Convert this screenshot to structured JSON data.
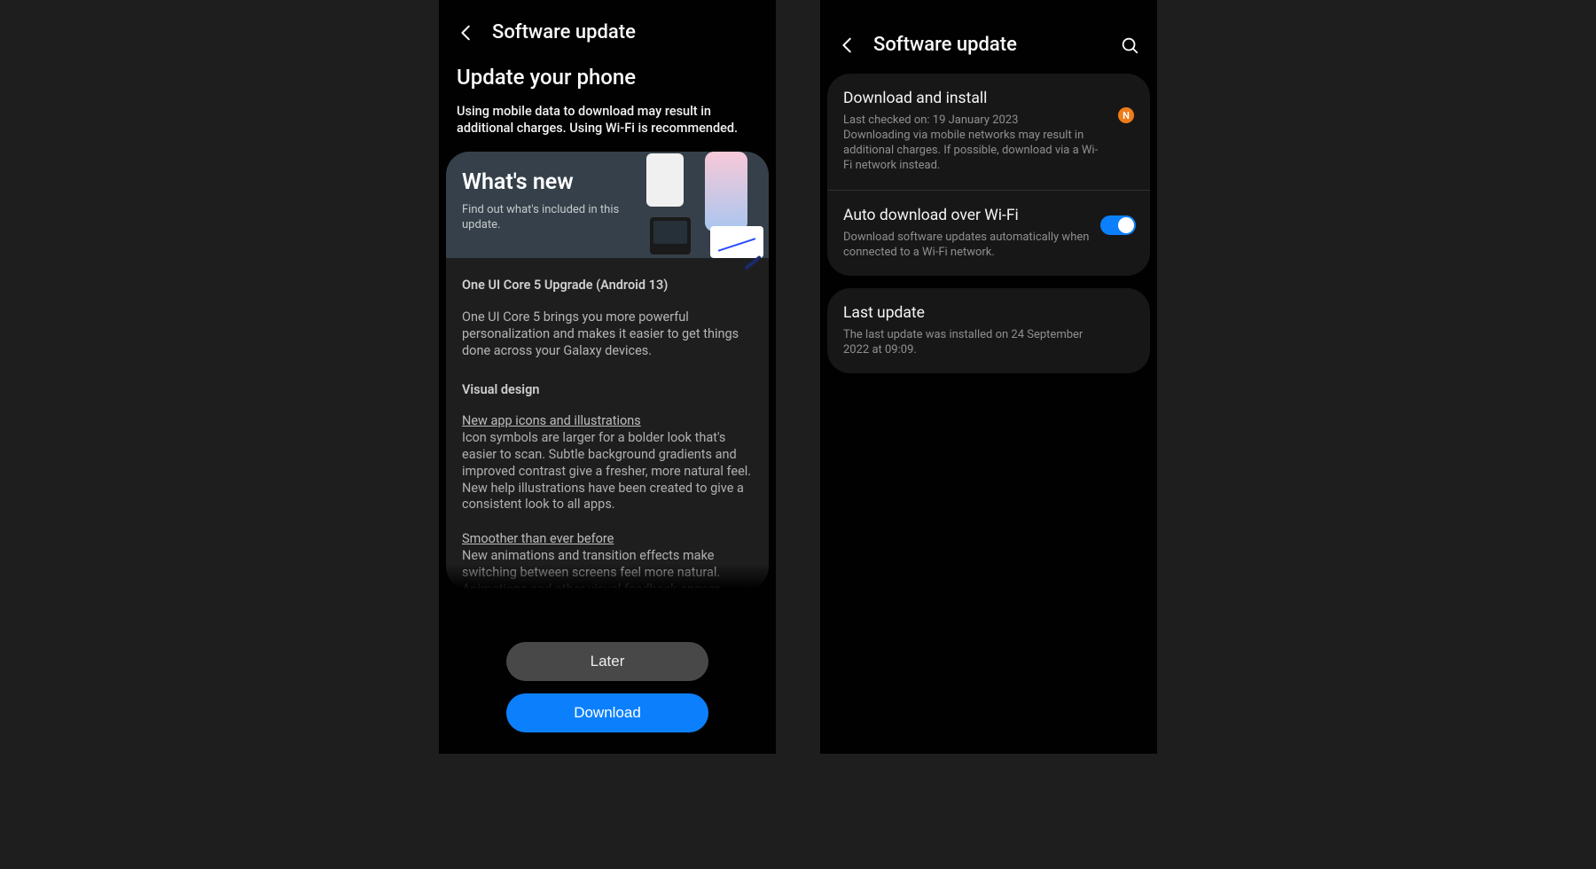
{
  "screen1": {
    "header_title": "Software update",
    "subhead_title": "Update your phone",
    "subhead_note": "Using mobile data to download may result in additional charges. Using Wi-Fi is recommended.",
    "whatsnew": {
      "title": "What's new",
      "subtitle": "Find out what's included in this update."
    },
    "release": {
      "title": "One UI Core 5 Upgrade (Android 13)",
      "intro": "One UI Core 5 brings you more powerful personalization and makes it easier to get things done across your Galaxy devices.",
      "section": "Visual design",
      "feat1_title": "New app icons and illustrations",
      "feat1_body": "Icon symbols are larger for a bolder look that's easier to scan. Subtle background gradients and improved contrast give a fresher, more natural feel. New help illustrations have been created to give a consistent look to all apps.",
      "feat2_title": "Smoother than ever before",
      "feat2_body": "New animations and transition effects make switching between screens feel more natural. Animations and other visual feedback appear instantly when you touch the screen, making"
    },
    "buttons": {
      "later": "Later",
      "download": "Download"
    }
  },
  "screen2": {
    "header_title": "Software update",
    "download_install": {
      "title": "Download and install",
      "sub": "Last checked on: 19 January 2023\nDownloading via mobile networks may result in additional charges. If possible, download via a Wi-Fi network instead.",
      "badge": "N"
    },
    "auto_wifi": {
      "title": "Auto download over Wi-Fi",
      "sub": "Download software updates automatically when connected to a Wi-Fi network.",
      "toggle_on": true
    },
    "last_update": {
      "title": "Last update",
      "sub": "The last update was installed on 24 September 2022 at 09:09."
    }
  }
}
